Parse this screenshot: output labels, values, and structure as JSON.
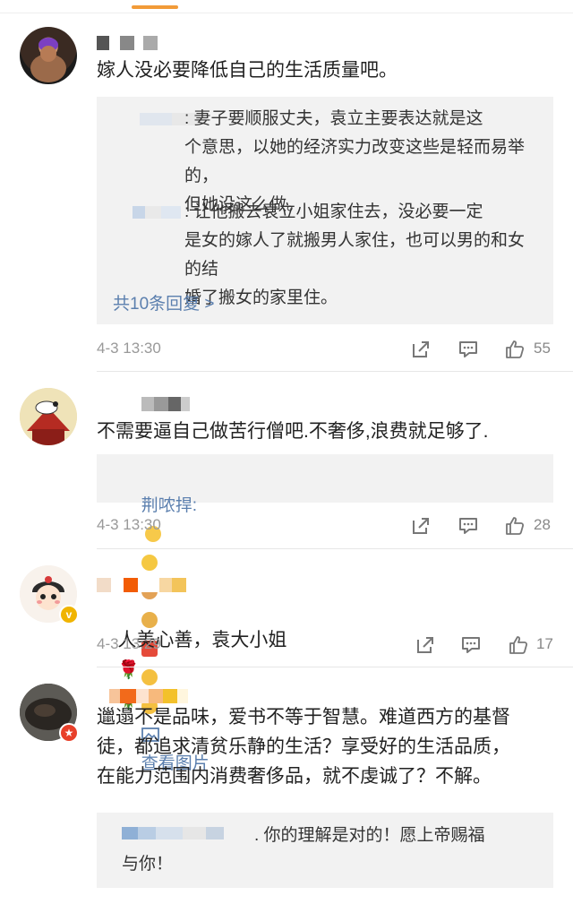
{
  "comments": [
    {
      "text": "嫁人没必要降低自己的生活质量吧。",
      "replies": [
        {
          "text": ": 妻子要顺服丈夫，袁立主要表达就是这\n个意思，以她的经济实力改变这些是轻而易举的，\n但她没这么做。"
        },
        {
          "text": ": 让他搬去袁立小姐家住去，没必要一定\n是女的嫁人了就搬男人家住，也可以男的和女的结\n婚了搬女的家里住。"
        }
      ],
      "more_replies": "共10条回复 >",
      "time": "4-3 13:30",
      "likes": "55"
    },
    {
      "text": "不需要逼自己做苦行僧吧.不奢侈,浪费就足够了.",
      "reply_author": "荆哝捍:",
      "reply_link": "查看图片",
      "time": "4-3 13:30",
      "likes": "28"
    },
    {
      "text": "人美心善，袁大小姐",
      "time": "4-3 13:29",
      "likes": "17"
    },
    {
      "text": "邋遢不是品味，爱书不等于智慧。难道西方的基督\n徒，都追求清贫乐静的生活？享受好的生活品质，\n在能力范围内消费奢侈品，就不虔诚了？不解。",
      "reply_text": ". 你的理解是对的！愿上帝赐福\n与你！"
    }
  ],
  "icons": {
    "share": "share-icon",
    "comment": "comment-icon",
    "like": "thumbs-up-icon",
    "rose": "rose-emoji",
    "image": "image-icon"
  },
  "colors": {
    "link": "#5b7fae",
    "accent": "#f29b38",
    "reply_bg": "#f2f2f2"
  }
}
